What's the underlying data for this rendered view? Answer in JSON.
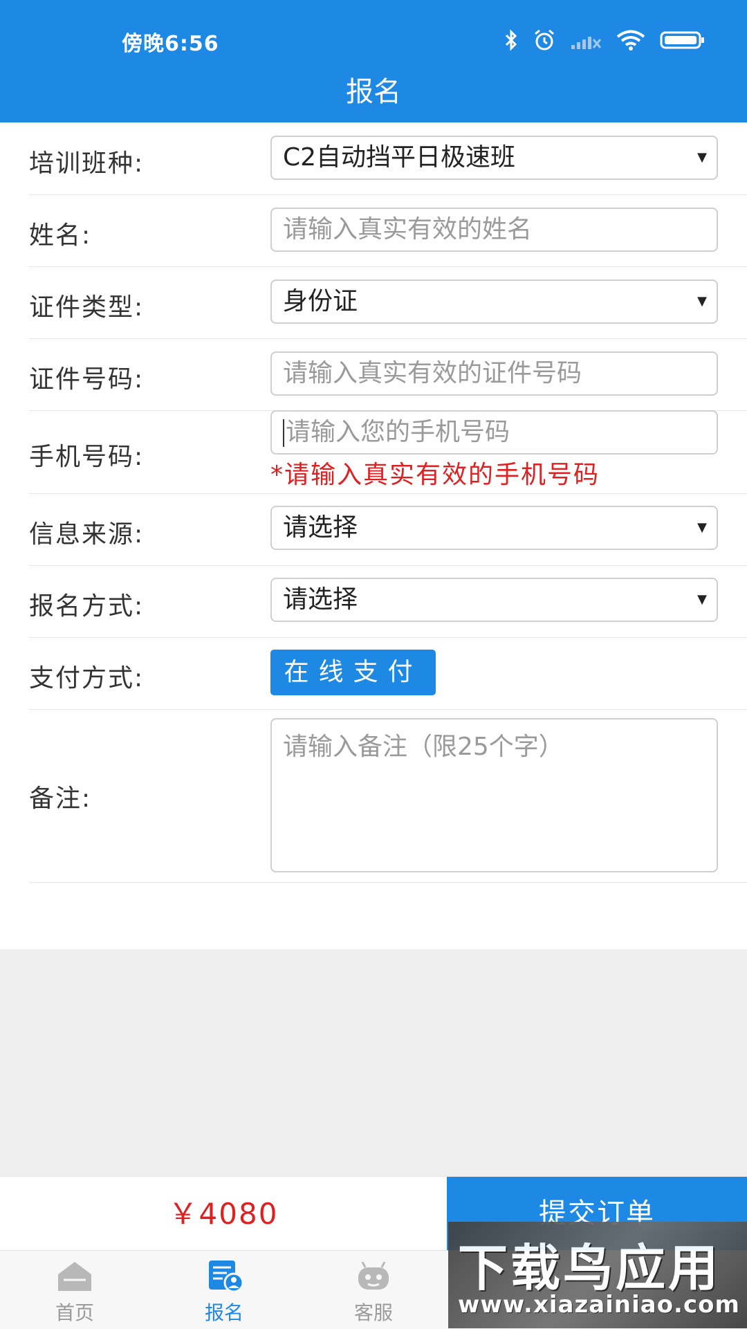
{
  "status_bar": {
    "time": "傍晚6:56"
  },
  "header": {
    "title": "报名"
  },
  "form": {
    "class_type": {
      "label": "培训班种:",
      "value": "C2自动挡平日极速班"
    },
    "name": {
      "label": "姓名:",
      "placeholder": "请输入真实有效的姓名"
    },
    "id_type": {
      "label": "证件类型:",
      "value": "身份证"
    },
    "id_number": {
      "label": "证件号码:",
      "placeholder": "请输入真实有效的证件号码"
    },
    "phone": {
      "label": "手机号码:",
      "placeholder": "请输入您的手机号码",
      "hint": "*请输入真实有效的手机号码"
    },
    "source": {
      "label": "信息来源:",
      "value": "请选择"
    },
    "signup_method": {
      "label": "报名方式:",
      "value": "请选择"
    },
    "payment": {
      "label": "支付方式:",
      "button": "在线支付"
    },
    "remark": {
      "label": "备注:",
      "placeholder": "请输入备注（限25个字）"
    }
  },
  "order": {
    "price": "￥4080",
    "submit_label": "提交订单"
  },
  "tabs": [
    {
      "label": "首页",
      "icon": "home-icon",
      "active": false
    },
    {
      "label": "报名",
      "icon": "signup-icon",
      "active": true
    },
    {
      "label": "客服",
      "icon": "robot-icon",
      "active": false
    }
  ],
  "watermark": {
    "title": "下载鸟应用",
    "url": "www.xiazainiao.com"
  },
  "colors": {
    "primary": "#1e88e5",
    "price": "#e02020",
    "hint": "#e02020",
    "gray_bg": "#efefef"
  }
}
